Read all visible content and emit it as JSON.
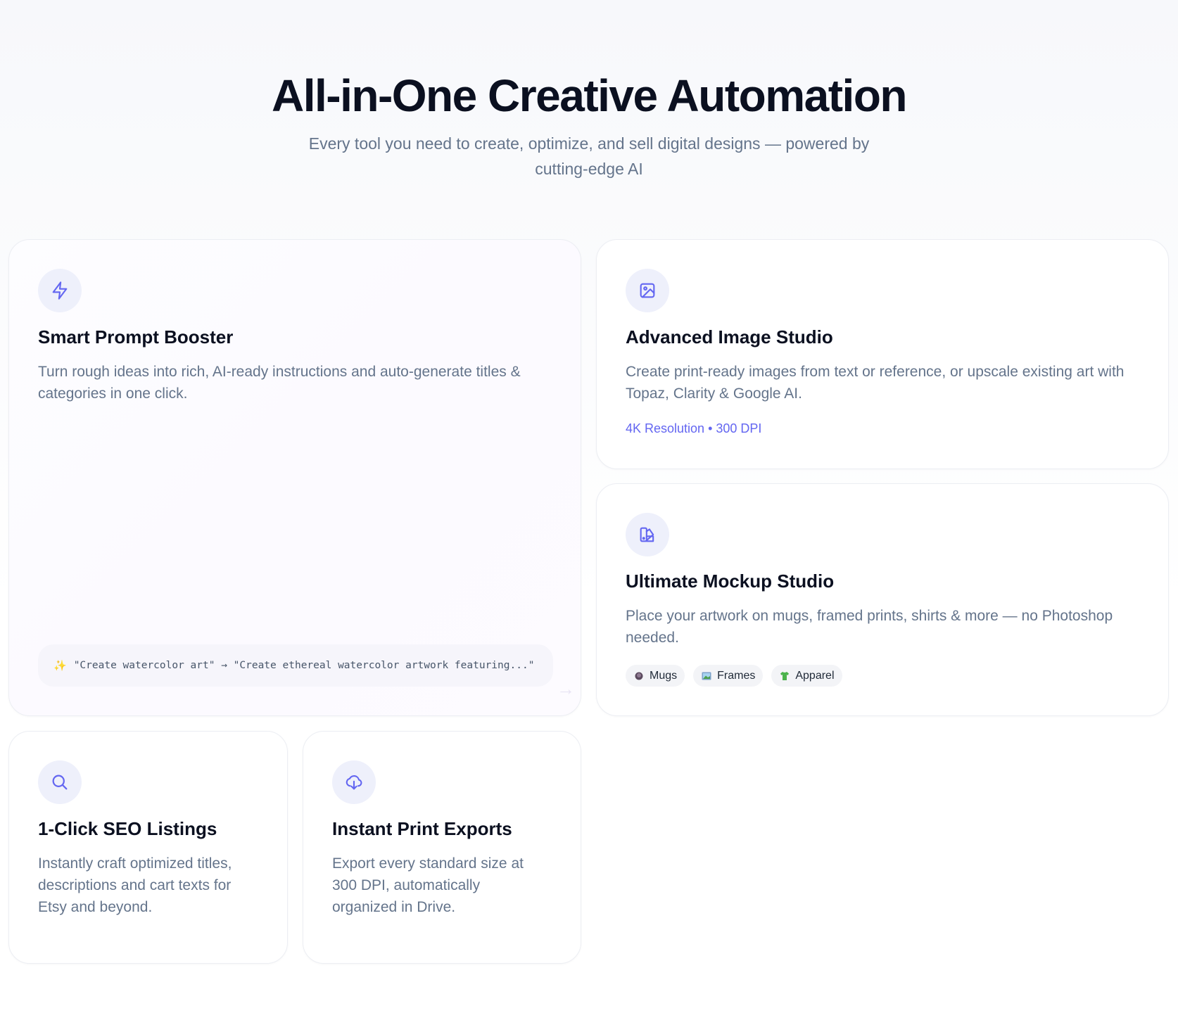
{
  "hero": {
    "title": "All-in-One Creative Automation",
    "subtitle": "Every tool you need to create, optimize, and sell digital designs — powered by cutting-edge AI"
  },
  "cards": {
    "prompt_booster": {
      "icon": "lightning-icon",
      "title": "Smart Prompt Booster",
      "description": "Turn rough ideas into rich, AI-ready instructions and auto-generate titles & categories in one click.",
      "example": "\"Create watercolor art\" → \"Create ethereal watercolor artwork featuring...\"",
      "example_icon": "sparkles-icon"
    },
    "image_studio": {
      "icon": "image-icon",
      "title": "Advanced Image Studio",
      "description": "Create print-ready images from text or reference, or upscale existing art with Topaz, Clarity & Google AI.",
      "spec": "4K Resolution • 300 DPI"
    },
    "mockup_studio": {
      "icon": "swatch-book-icon",
      "title": "Ultimate Mockup Studio",
      "description": "Place your artwork on mugs, framed prints, shirts & more — no Photoshop needed.",
      "tags": [
        {
          "label": "Mugs",
          "icon": "mug-icon"
        },
        {
          "label": "Frames",
          "icon": "framed-picture-icon"
        },
        {
          "label": "Apparel",
          "icon": "tshirt-icon"
        }
      ]
    },
    "seo_listings": {
      "icon": "search-icon",
      "title": "1-Click SEO Listings",
      "description": "Instantly craft optimized titles, descriptions and cart texts for Etsy and beyond."
    },
    "print_exports": {
      "icon": "cloud-download-icon",
      "title": "Instant Print Exports",
      "description": "Export every standard size at 300 DPI, automatically organized in Drive."
    }
  },
  "colors": {
    "accent": "#6366f1",
    "icon_badge_bg": "#eef0fb",
    "heading": "#0b1020",
    "body_text": "#64748b"
  }
}
